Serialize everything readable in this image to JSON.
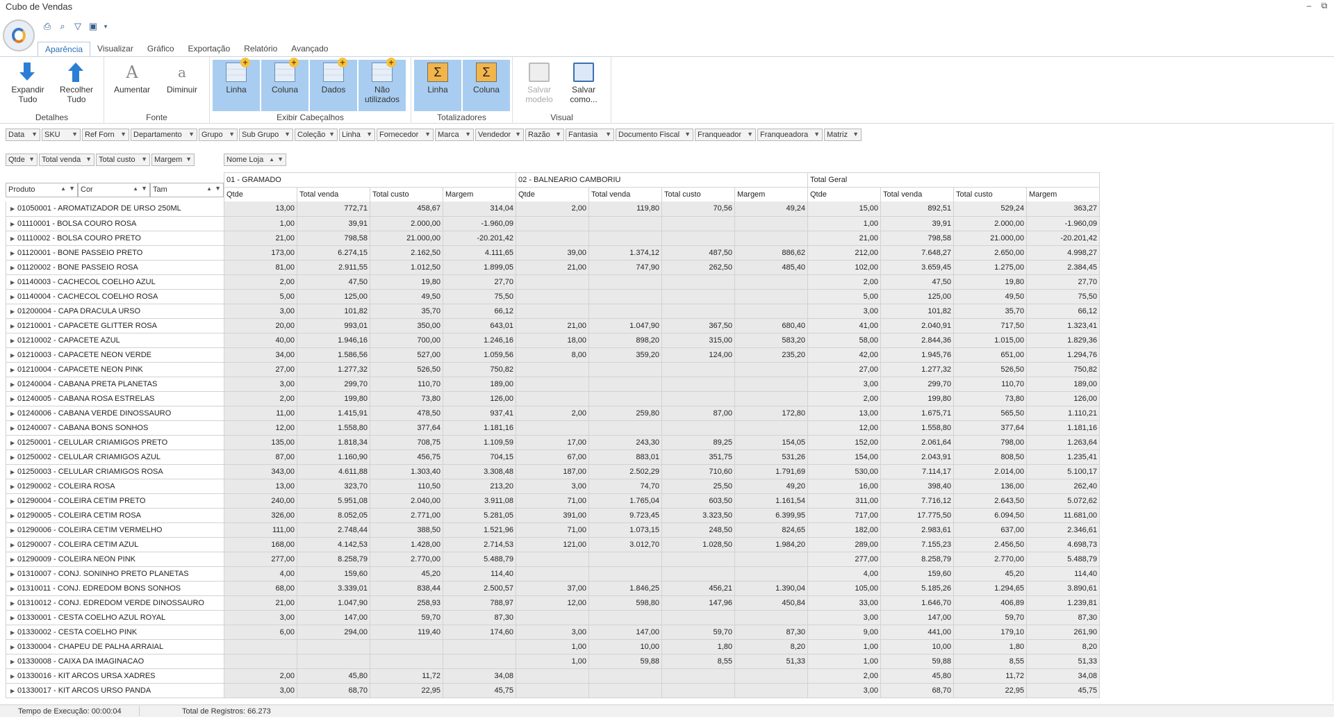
{
  "window": {
    "title": "Cubo de Vendas",
    "minimize": "–",
    "restore": "⧉"
  },
  "tabs": [
    "Aparência",
    "Visualizar",
    "Gráfico",
    "Exportação",
    "Relatório",
    "Avançado"
  ],
  "ribbon": {
    "groups": {
      "detalhes": "Detalhes",
      "fonte": "Fonte",
      "exibir": "Exibir Cabeçalhos",
      "totalizadores": "Totalizadores",
      "visual": "Visual"
    },
    "expandir_l1": "Expandir",
    "expandir_l2": "Tudo",
    "recolher_l1": "Recolher",
    "recolher_l2": "Tudo",
    "aumentar": "Aumentar",
    "diminuir": "Diminuir",
    "linha": "Linha",
    "coluna": "Coluna",
    "dados": "Dados",
    "nao_l1": "Não",
    "nao_l2": "utilizados",
    "tot_linha": "Linha",
    "tot_coluna": "Coluna",
    "salvar_modelo_l1": "Salvar",
    "salvar_modelo_l2": "modelo",
    "salvar_como_l1": "Salvar",
    "salvar_como_l2": "como..."
  },
  "filter_fields": [
    "Data",
    "SKU",
    "Ref Forn",
    "Departamento",
    "Grupo",
    "Sub Grupo",
    "Coleção",
    "Linha",
    "Fornecedor",
    "Marca",
    "Vendedor",
    "Razão",
    "Fantasia",
    "Documento Fiscal",
    "Franqueador",
    "Franqueadora",
    "Matriz"
  ],
  "data_fields": [
    "Qtde",
    "Total venda",
    "Total custo",
    "Margem"
  ],
  "column_field": "Nome Loja",
  "row_fields": [
    "Produto",
    "Cor",
    "Tam"
  ],
  "stores": [
    "01 - GRAMADO",
    "02 - BALNEARIO CAMBORIU",
    "Total Geral"
  ],
  "measures": [
    "Qtde",
    "Total venda",
    "Total custo",
    "Margem"
  ],
  "rows": [
    {
      "p": "01050001 - AROMATIZADOR DE URSO 250ML",
      "v": [
        "13,00",
        "772,71",
        "458,67",
        "314,04",
        "2,00",
        "119,80",
        "70,56",
        "49,24",
        "15,00",
        "892,51",
        "529,24",
        "363,27"
      ]
    },
    {
      "p": "01110001 - BOLSA COURO ROSA",
      "v": [
        "1,00",
        "39,91",
        "2.000,00",
        "-1.960,09",
        "",
        "",
        "",
        "",
        "1,00",
        "39,91",
        "2.000,00",
        "-1.960,09"
      ]
    },
    {
      "p": "01110002 - BOLSA COURO PRETO",
      "v": [
        "21,00",
        "798,58",
        "21.000,00",
        "-20.201,42",
        "",
        "",
        "",
        "",
        "21,00",
        "798,58",
        "21.000,00",
        "-20.201,42"
      ]
    },
    {
      "p": "01120001 - BONE PASSEIO PRETO",
      "v": [
        "173,00",
        "6.274,15",
        "2.162,50",
        "4.111,65",
        "39,00",
        "1.374,12",
        "487,50",
        "886,62",
        "212,00",
        "7.648,27",
        "2.650,00",
        "4.998,27"
      ]
    },
    {
      "p": "01120002 - BONE PASSEIO ROSA",
      "v": [
        "81,00",
        "2.911,55",
        "1.012,50",
        "1.899,05",
        "21,00",
        "747,90",
        "262,50",
        "485,40",
        "102,00",
        "3.659,45",
        "1.275,00",
        "2.384,45"
      ]
    },
    {
      "p": "01140003 - CACHECOL COELHO AZUL",
      "v": [
        "2,00",
        "47,50",
        "19,80",
        "27,70",
        "",
        "",
        "",
        "",
        "2,00",
        "47,50",
        "19,80",
        "27,70"
      ]
    },
    {
      "p": "01140004 - CACHECOL COELHO ROSA",
      "v": [
        "5,00",
        "125,00",
        "49,50",
        "75,50",
        "",
        "",
        "",
        "",
        "5,00",
        "125,00",
        "49,50",
        "75,50"
      ]
    },
    {
      "p": "01200004 - CAPA DRACULA URSO",
      "v": [
        "3,00",
        "101,82",
        "35,70",
        "66,12",
        "",
        "",
        "",
        "",
        "3,00",
        "101,82",
        "35,70",
        "66,12"
      ]
    },
    {
      "p": "01210001 - CAPACETE GLITTER ROSA",
      "v": [
        "20,00",
        "993,01",
        "350,00",
        "643,01",
        "21,00",
        "1.047,90",
        "367,50",
        "680,40",
        "41,00",
        "2.040,91",
        "717,50",
        "1.323,41"
      ]
    },
    {
      "p": "01210002 - CAPACETE AZUL",
      "v": [
        "40,00",
        "1.946,16",
        "700,00",
        "1.246,16",
        "18,00",
        "898,20",
        "315,00",
        "583,20",
        "58,00",
        "2.844,36",
        "1.015,00",
        "1.829,36"
      ]
    },
    {
      "p": "01210003 - CAPACETE NEON VERDE",
      "v": [
        "34,00",
        "1.586,56",
        "527,00",
        "1.059,56",
        "8,00",
        "359,20",
        "124,00",
        "235,20",
        "42,00",
        "1.945,76",
        "651,00",
        "1.294,76"
      ]
    },
    {
      "p": "01210004 - CAPACETE NEON PINK",
      "v": [
        "27,00",
        "1.277,32",
        "526,50",
        "750,82",
        "",
        "",
        "",
        "",
        "27,00",
        "1.277,32",
        "526,50",
        "750,82"
      ]
    },
    {
      "p": "01240004 - CABANA PRETA PLANETAS",
      "v": [
        "3,00",
        "299,70",
        "110,70",
        "189,00",
        "",
        "",
        "",
        "",
        "3,00",
        "299,70",
        "110,70",
        "189,00"
      ]
    },
    {
      "p": "01240005 - CABANA ROSA ESTRELAS",
      "v": [
        "2,00",
        "199,80",
        "73,80",
        "126,00",
        "",
        "",
        "",
        "",
        "2,00",
        "199,80",
        "73,80",
        "126,00"
      ]
    },
    {
      "p": "01240006 - CABANA VERDE DINOSSAURO",
      "v": [
        "11,00",
        "1.415,91",
        "478,50",
        "937,41",
        "2,00",
        "259,80",
        "87,00",
        "172,80",
        "13,00",
        "1.675,71",
        "565,50",
        "1.110,21"
      ]
    },
    {
      "p": "01240007 - CABANA BONS SONHOS",
      "v": [
        "12,00",
        "1.558,80",
        "377,64",
        "1.181,16",
        "",
        "",
        "",
        "",
        "12,00",
        "1.558,80",
        "377,64",
        "1.181,16"
      ]
    },
    {
      "p": "01250001 - CELULAR CRIAMIGOS PRETO",
      "v": [
        "135,00",
        "1.818,34",
        "708,75",
        "1.109,59",
        "17,00",
        "243,30",
        "89,25",
        "154,05",
        "152,00",
        "2.061,64",
        "798,00",
        "1.263,64"
      ]
    },
    {
      "p": "01250002 - CELULAR CRIAMIGOS AZUL",
      "v": [
        "87,00",
        "1.160,90",
        "456,75",
        "704,15",
        "67,00",
        "883,01",
        "351,75",
        "531,26",
        "154,00",
        "2.043,91",
        "808,50",
        "1.235,41"
      ]
    },
    {
      "p": "01250003 - CELULAR CRIAMIGOS ROSA",
      "v": [
        "343,00",
        "4.611,88",
        "1.303,40",
        "3.308,48",
        "187,00",
        "2.502,29",
        "710,60",
        "1.791,69",
        "530,00",
        "7.114,17",
        "2.014,00",
        "5.100,17"
      ]
    },
    {
      "p": "01290002 - COLEIRA ROSA",
      "v": [
        "13,00",
        "323,70",
        "110,50",
        "213,20",
        "3,00",
        "74,70",
        "25,50",
        "49,20",
        "16,00",
        "398,40",
        "136,00",
        "262,40"
      ]
    },
    {
      "p": "01290004 - COLEIRA CETIM PRETO",
      "v": [
        "240,00",
        "5.951,08",
        "2.040,00",
        "3.911,08",
        "71,00",
        "1.765,04",
        "603,50",
        "1.161,54",
        "311,00",
        "7.716,12",
        "2.643,50",
        "5.072,62"
      ]
    },
    {
      "p": "01290005 - COLEIRA CETIM ROSA",
      "v": [
        "326,00",
        "8.052,05",
        "2.771,00",
        "5.281,05",
        "391,00",
        "9.723,45",
        "3.323,50",
        "6.399,95",
        "717,00",
        "17.775,50",
        "6.094,50",
        "11.681,00"
      ]
    },
    {
      "p": "01290006 - COLEIRA CETIM VERMELHO",
      "v": [
        "111,00",
        "2.748,44",
        "388,50",
        "1.521,96",
        "71,00",
        "1.073,15",
        "248,50",
        "824,65",
        "182,00",
        "2.983,61",
        "637,00",
        "2.346,61"
      ]
    },
    {
      "p": "01290007 - COLEIRA CETIM AZUL",
      "v": [
        "168,00",
        "4.142,53",
        "1.428,00",
        "2.714,53",
        "121,00",
        "3.012,70",
        "1.028,50",
        "1.984,20",
        "289,00",
        "7.155,23",
        "2.456,50",
        "4.698,73"
      ]
    },
    {
      "p": "01290009 - COLEIRA NEON PINK",
      "v": [
        "277,00",
        "8.258,79",
        "2.770,00",
        "5.488,79",
        "",
        "",
        "",
        "",
        "277,00",
        "8.258,79",
        "2.770,00",
        "5.488,79"
      ]
    },
    {
      "p": "01310007 - CONJ. SONINHO PRETO PLANETAS",
      "v": [
        "4,00",
        "159,60",
        "45,20",
        "114,40",
        "",
        "",
        "",
        "",
        "4,00",
        "159,60",
        "45,20",
        "114,40"
      ]
    },
    {
      "p": "01310011 - CONJ. EDREDOM BONS SONHOS",
      "v": [
        "68,00",
        "3.339,01",
        "838,44",
        "2.500,57",
        "37,00",
        "1.846,25",
        "456,21",
        "1.390,04",
        "105,00",
        "5.185,26",
        "1.294,65",
        "3.890,61"
      ]
    },
    {
      "p": "01310012 - CONJ. EDREDOM VERDE DINOSSAURO",
      "v": [
        "21,00",
        "1.047,90",
        "258,93",
        "788,97",
        "12,00",
        "598,80",
        "147,96",
        "450,84",
        "33,00",
        "1.646,70",
        "406,89",
        "1.239,81"
      ]
    },
    {
      "p": "01330001 - CESTA COELHO AZUL ROYAL",
      "v": [
        "3,00",
        "147,00",
        "59,70",
        "87,30",
        "",
        "",
        "",
        "",
        "3,00",
        "147,00",
        "59,70",
        "87,30"
      ]
    },
    {
      "p": "01330002 - CESTA COELHO PINK",
      "v": [
        "6,00",
        "294,00",
        "119,40",
        "174,60",
        "3,00",
        "147,00",
        "59,70",
        "87,30",
        "9,00",
        "441,00",
        "179,10",
        "261,90"
      ]
    },
    {
      "p": "01330004 - CHAPEU DE PALHA ARRAIAL",
      "v": [
        "",
        "",
        "",
        "",
        "1,00",
        "10,00",
        "1,80",
        "8,20",
        "1,00",
        "10,00",
        "1,80",
        "8,20"
      ]
    },
    {
      "p": "01330008 - CAIXA DA IMAGINACAO",
      "v": [
        "",
        "",
        "",
        "",
        "1,00",
        "59,88",
        "8,55",
        "51,33",
        "1,00",
        "59,88",
        "8,55",
        "51,33"
      ]
    },
    {
      "p": "01330016 - KIT ARCOS URSA XADRES",
      "v": [
        "2,00",
        "45,80",
        "11,72",
        "34,08",
        "",
        "",
        "",
        "",
        "2,00",
        "45,80",
        "11,72",
        "34,08"
      ]
    },
    {
      "p": "01330017 - KIT ARCOS URSO PANDA",
      "v": [
        "3,00",
        "68,70",
        "22,95",
        "45,75",
        "",
        "",
        "",
        "",
        "3,00",
        "68,70",
        "22,95",
        "45,75"
      ]
    }
  ],
  "status": {
    "tempo": "Tempo de Execução: 00:00:04",
    "registros": "Total de Registros: 66.273"
  }
}
